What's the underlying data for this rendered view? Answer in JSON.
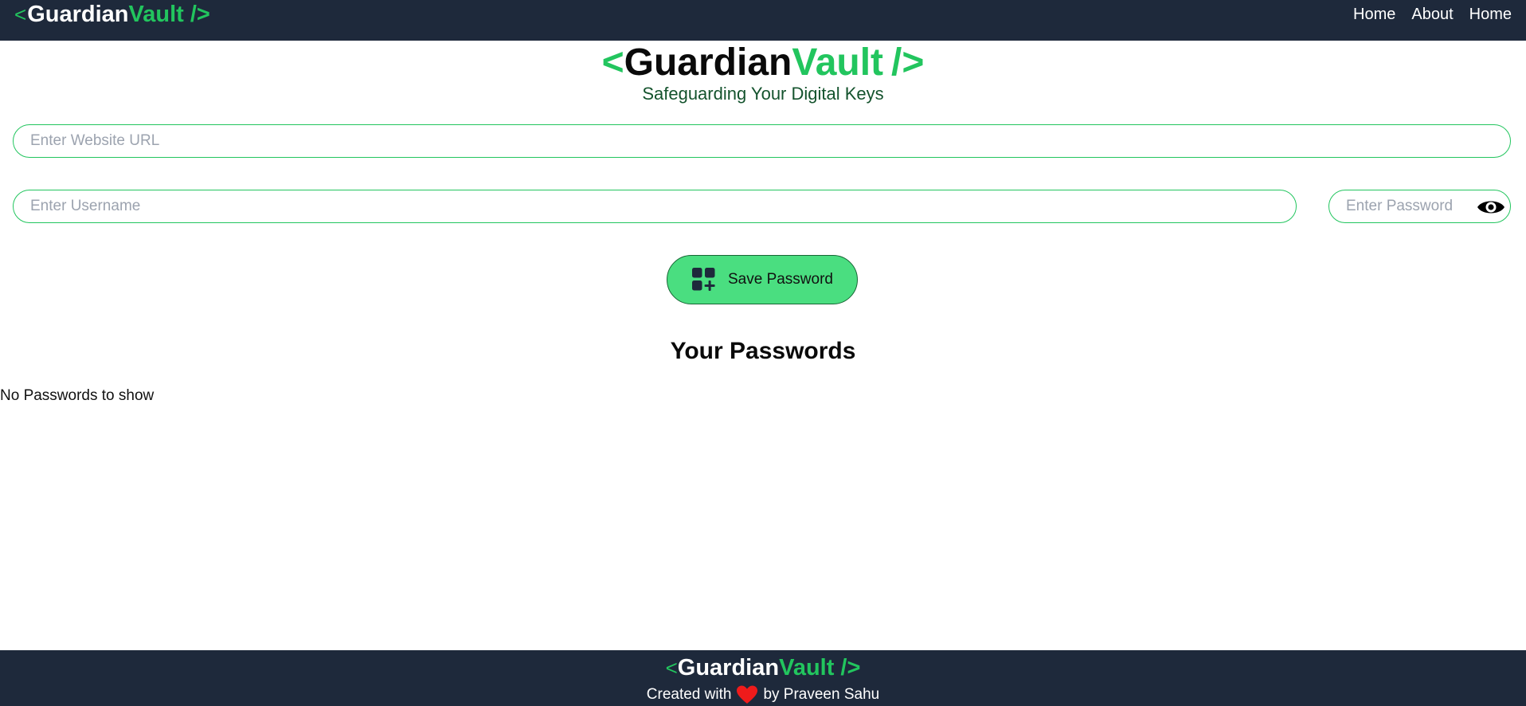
{
  "navbar": {
    "logo": {
      "open": "<",
      "brand_a": "Guardian",
      "brand_b": "Vault",
      "close": "/>"
    },
    "links": [
      "Home",
      "About",
      "Home"
    ]
  },
  "hero": {
    "title": {
      "open": "<",
      "brand_a": "Guardian",
      "brand_b": "Vault",
      "close": "/>"
    },
    "subtitle": "Safeguarding Your Digital Keys"
  },
  "form": {
    "url_placeholder": "Enter Website URL",
    "url_value": "",
    "username_placeholder": "Enter Username",
    "username_value": "",
    "password_placeholder": "Enter Password",
    "password_value": "",
    "password_toggle_icon": "eye-icon",
    "save_icon": "add-grid-icon",
    "save_label": "Save Password"
  },
  "passwords": {
    "heading": "Your Passwords",
    "empty_message": "No Passwords to show"
  },
  "footer": {
    "logo": {
      "open": "<",
      "brand_a": "Guardian",
      "brand_b": "Vault",
      "close": "/>"
    },
    "credit_prefix": "Created with",
    "credit_icon": "heart-icon",
    "credit_suffix": "by Praveen Sahu"
  },
  "colors": {
    "navbar_bg": "#1e293b",
    "accent": "#22c55e",
    "button_bg": "#4ade80",
    "heart": "#ef1b1b"
  }
}
